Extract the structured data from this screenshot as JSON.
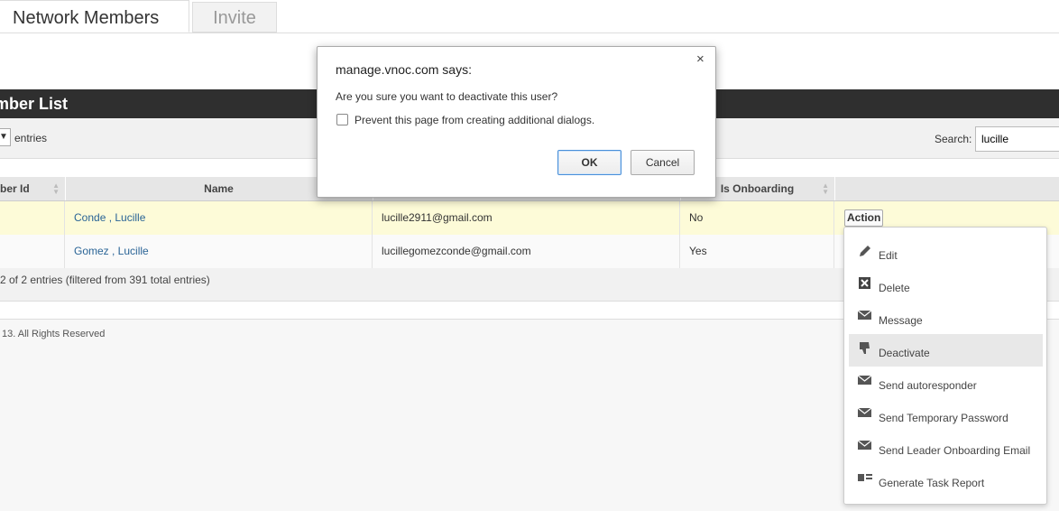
{
  "tabs": [
    {
      "label": "Network Members",
      "active": true
    },
    {
      "label": "Invite",
      "active": false
    }
  ],
  "panel": {
    "title": "mber List"
  },
  "controls": {
    "entries_label": "entries",
    "search_label": "Search:",
    "search_value": "lucille"
  },
  "table": {
    "headers": [
      "ber Id",
      "Name",
      "",
      "Is Onboarding",
      ""
    ],
    "rows": [
      {
        "name": "Conde , Lucille",
        "email": "lucille2911@gmail.com",
        "onboarding": "No"
      },
      {
        "name": "Gomez , Lucille",
        "email": "lucillegomezconde@gmail.com",
        "onboarding": "Yes"
      }
    ],
    "info": "2 of 2 entries (filtered from 391 total entries)"
  },
  "footer": {
    "text": "13. All Rights Reserved"
  },
  "action": {
    "button_label": "Action",
    "menu": [
      {
        "label": "Edit",
        "icon": "pencil-icon"
      },
      {
        "label": "Delete",
        "icon": "delete-x-icon"
      },
      {
        "label": "Message",
        "icon": "envelope-icon"
      },
      {
        "label": "Deactivate",
        "icon": "thumbs-down-icon"
      },
      {
        "label": "Send autoresponder",
        "icon": "envelope-icon"
      },
      {
        "label": "Send Temporary Password",
        "icon": "envelope-icon"
      },
      {
        "label": "Send Leader Onboarding Email",
        "icon": "envelope-icon"
      },
      {
        "label": "Generate Task Report",
        "icon": "report-icon"
      }
    ]
  },
  "dialog": {
    "title": "manage.vnoc.com says:",
    "message": "Are you sure you want to deactivate this user?",
    "checkbox_label": "Prevent this page from creating additional dialogs.",
    "ok_label": "OK",
    "cancel_label": "Cancel",
    "close_glyph": "×"
  },
  "colors": {
    "header_bg": "#2f2f2f",
    "highlight_row": "#fdfbd8",
    "link": "#2a6496",
    "ok_border": "#4a90d9"
  }
}
